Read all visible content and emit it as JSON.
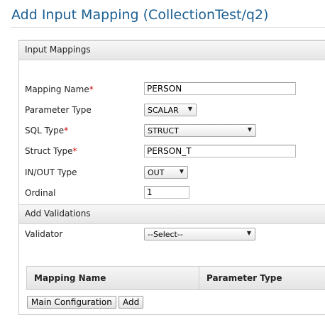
{
  "page": {
    "title": "Add Input Mapping (CollectionTest/q2)"
  },
  "input_mappings": {
    "heading": "Input Mappings",
    "mapping_name": {
      "label": "Mapping Name",
      "required_mark": "*",
      "value": "PERSON"
    },
    "parameter_type": {
      "label": "Parameter Type",
      "value": "SCALAR"
    },
    "sql_type": {
      "label": "SQL Type",
      "required_mark": "*",
      "value": "STRUCT"
    },
    "struct_type": {
      "label": "Struct Type",
      "required_mark": "*",
      "value": "PERSON_T"
    },
    "in_out_type": {
      "label": "IN/OUT Type",
      "value": "OUT"
    },
    "ordinal": {
      "label": "Ordinal",
      "value": "1"
    }
  },
  "validations": {
    "heading": "Add Validations",
    "validator": {
      "label": "Validator",
      "value": "--Select--"
    },
    "table": {
      "columns": [
        "Mapping Name",
        "Parameter Type"
      ]
    }
  },
  "buttons": {
    "main_configuration": "Main Configuration",
    "add": "Add"
  },
  "icons": {
    "dropdown_arrow": "▼"
  },
  "colors": {
    "title": "#1c5f92",
    "required": "#cc0000"
  }
}
